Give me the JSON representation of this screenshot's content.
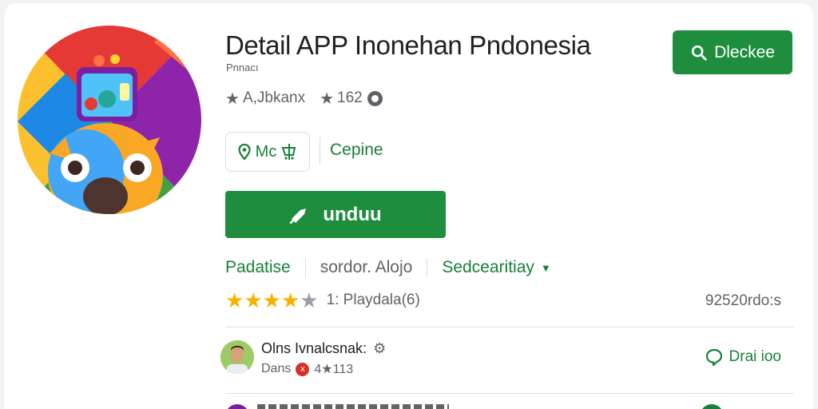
{
  "app": {
    "title": "Detail APP Inonehan Pndonesia",
    "subtitle": "Pnnacı",
    "developer": "A,Jbkanx",
    "rating_count_short": "162"
  },
  "header": {
    "action_label": "Dleckee",
    "action_icon": "search-icon"
  },
  "chips": {
    "primary_label": "Mc",
    "secondary_label": "Cepine"
  },
  "install": {
    "label": "unduu",
    "icon": "rocket-icon"
  },
  "links": {
    "category": "Padatise",
    "content_rating": "sordor. Alojo",
    "more": "Sedcearitiay"
  },
  "rating": {
    "stars": 4,
    "max": 5,
    "text": "1: Playdala(6)",
    "downloads": "92520rdo:s"
  },
  "review": {
    "name": "Olns Ivnalcsnak:",
    "meta_name": "Dans",
    "meta_badge": "x",
    "meta_score": "4★113",
    "reply_label": "Drai ioo"
  },
  "colors": {
    "brand_green": "#1e8e3e",
    "text_green": "#188038",
    "star_yellow": "#f5b301"
  }
}
